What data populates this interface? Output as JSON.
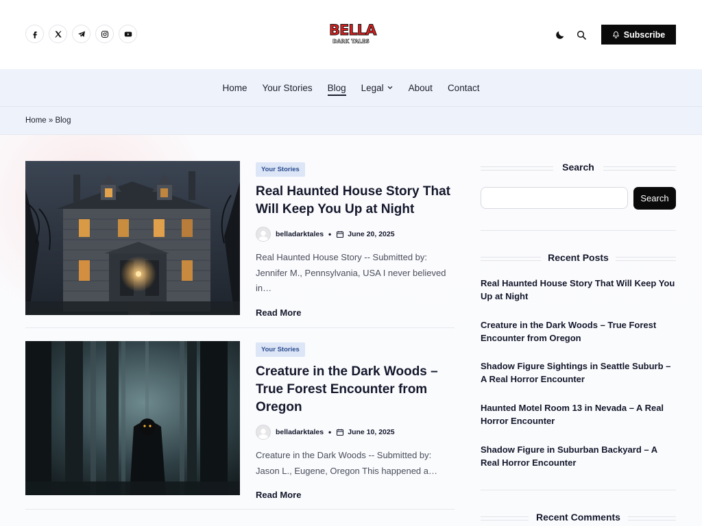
{
  "header": {
    "logo_main": "BELLA",
    "logo_sub": "DARK TALES",
    "subscribe_label": "Subscribe"
  },
  "nav": {
    "items": [
      "Home",
      "Your Stories",
      "Blog",
      "Legal",
      "About",
      "Contact"
    ],
    "active": "Blog"
  },
  "breadcrumb": "Home » Blog",
  "posts": [
    {
      "category": "Your Stories",
      "title": "Real Haunted House Story That Will Keep You Up at Night",
      "author": "belladarktales",
      "date": "June 20, 2025",
      "excerpt": "Real Haunted House Story -- Submitted by: Jennifer M., Pennsylvania, USA I never believed in…",
      "read_more": "Read More"
    },
    {
      "category": "Your Stories",
      "title": "Creature in the Dark Woods – True Forest Encounter from Oregon",
      "author": "belladarktales",
      "date": "June 10, 2025",
      "excerpt": "Creature in the Dark Woods -- Submitted by: Jason L., Eugene, Oregon This happened a…",
      "read_more": "Read More"
    }
  ],
  "sidebar": {
    "search_title": "Search",
    "search_button": "Search",
    "recent_title": "Recent Posts",
    "recent_posts": [
      "Real Haunted House Story That Will Keep You Up at Night",
      "Creature in the Dark Woods – True Forest Encounter from Oregon",
      "Shadow Figure Sightings in Seattle Suburb – A Real Horror Encounter",
      "Haunted Motel Room 13 in Nevada – A Real Horror Encounter",
      "Shadow Figure in Suburban Backyard – A Real Horror Encounter"
    ],
    "comments_title": "Recent Comments"
  },
  "colors": {
    "accent_dark": "#0a0a0a",
    "nav_bg": "#eef3fb",
    "category_bg": "#dce6f7",
    "logo_red": "#e02020"
  }
}
